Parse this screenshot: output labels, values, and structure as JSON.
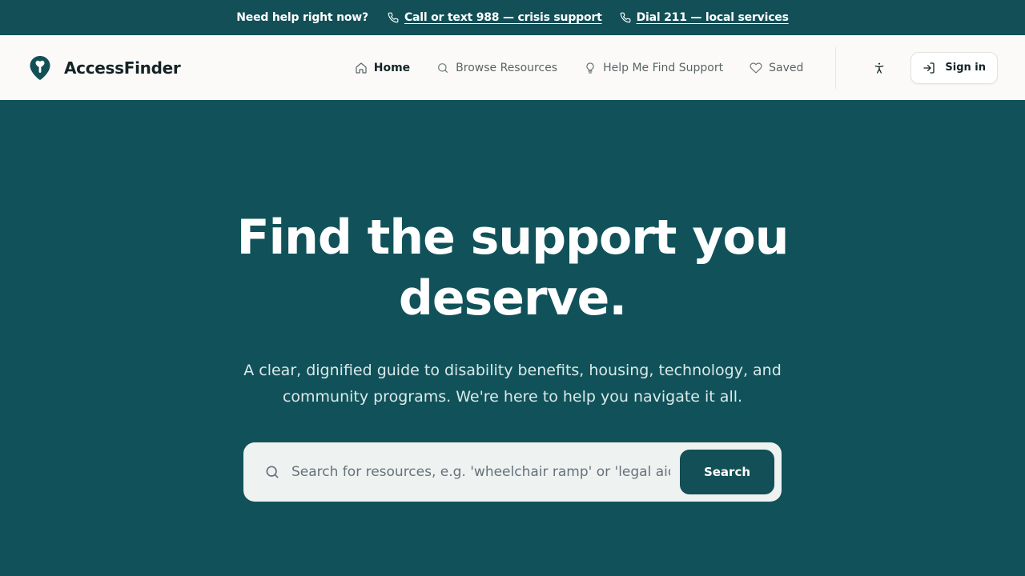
{
  "topbar": {
    "lead": "Need help right now?",
    "links": [
      {
        "label": "Call or text 988 — crisis support",
        "icon": "phone-icon"
      },
      {
        "label": "Dial 211 — local services",
        "icon": "phone-icon"
      }
    ]
  },
  "brand": {
    "name": "AccessFinder",
    "icon": "map-pin-logo"
  },
  "nav": {
    "items": [
      {
        "label": "Home",
        "icon": "home-icon",
        "active": true
      },
      {
        "label": "Browse Resources",
        "icon": "search-icon",
        "active": false
      },
      {
        "label": "Help Me Find Support",
        "icon": "lightbulb-icon",
        "active": false
      },
      {
        "label": "Saved",
        "icon": "heart-icon",
        "active": false
      }
    ],
    "accessibility_icon": "accessibility-icon",
    "sign_in": "Sign in"
  },
  "hero": {
    "title": "Find the support you deserve.",
    "subtitle": "A clear, dignified guide to disability benefits, housing, technology, and community programs. We're here to help you navigate it all.",
    "search": {
      "placeholder": "Search for resources, e.g. 'wheelchair ramp' or 'legal aid'",
      "value": "",
      "button": "Search"
    }
  },
  "colors": {
    "primary": "#124f56",
    "hero_bg": "#11525a",
    "nav_bg": "#fbfaf8",
    "search_bg": "#eef2f1"
  }
}
